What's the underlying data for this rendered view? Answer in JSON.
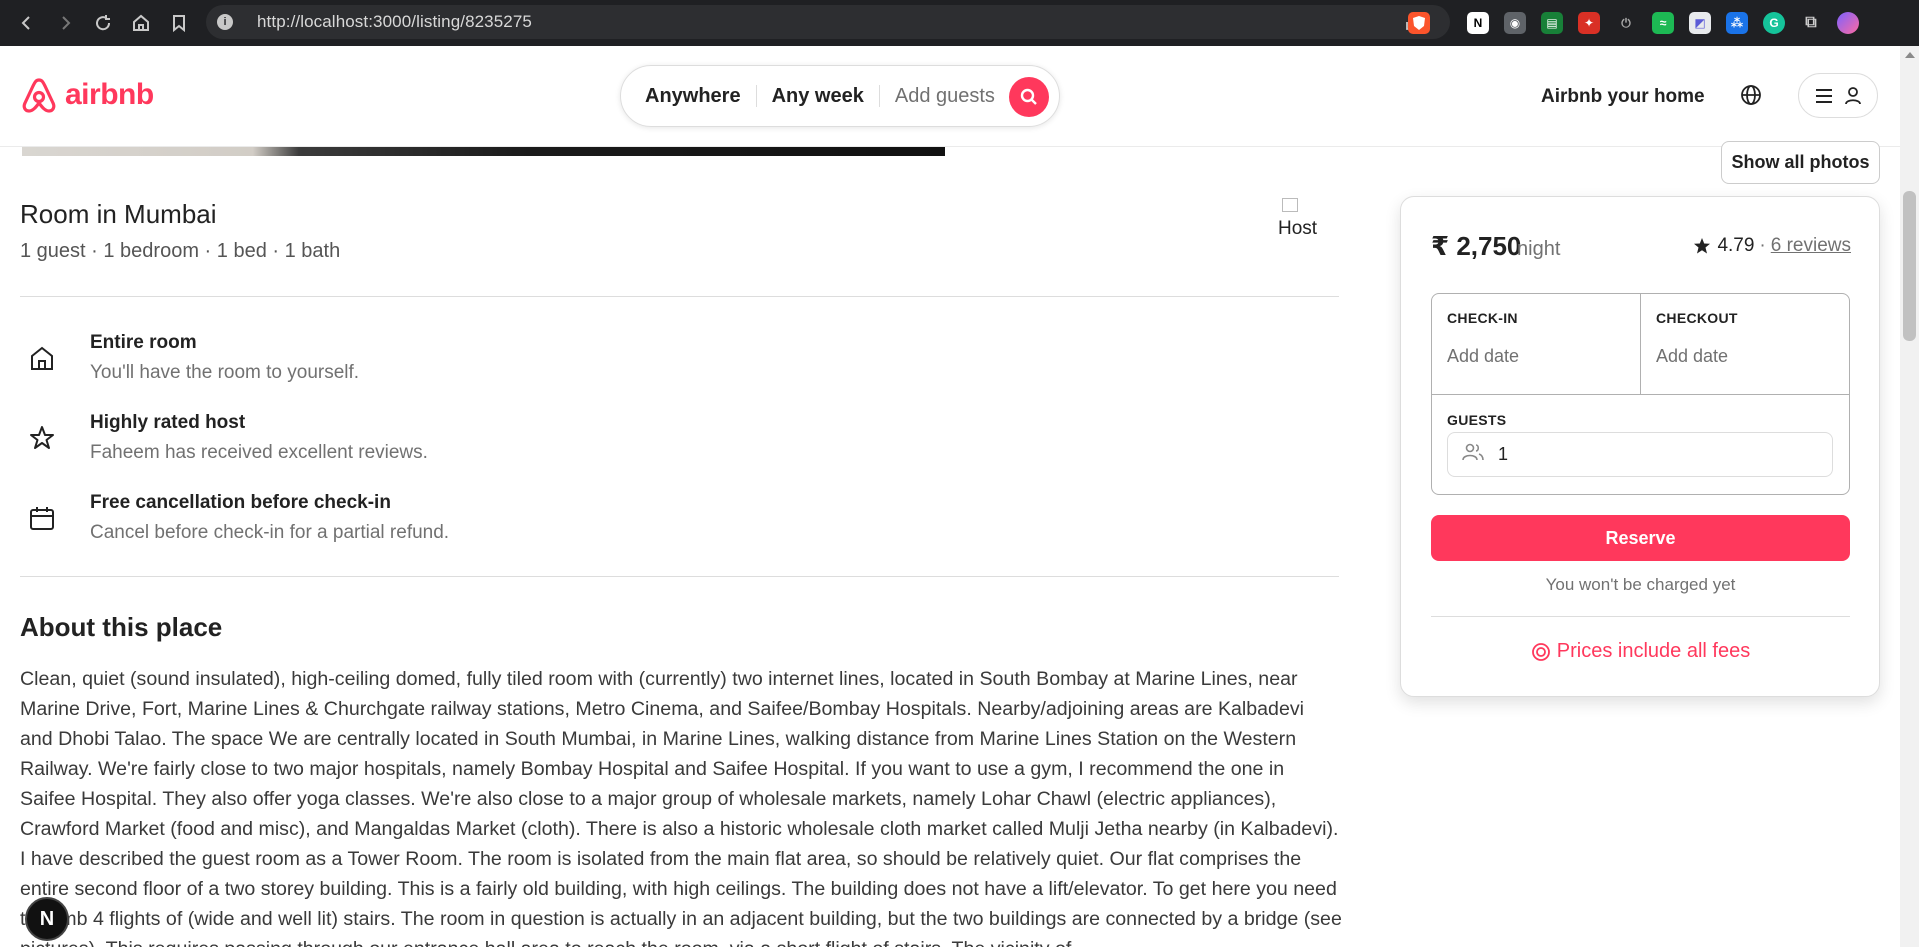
{
  "browser": {
    "url": "http://localhost:3000/listing/8235275",
    "info_icon": "i"
  },
  "header": {
    "logo_text": "airbnb",
    "search": {
      "where": "Anywhere",
      "when": "Any week",
      "guests_placeholder": "Add guests"
    },
    "host_link": "Airbnb your home",
    "brand_color": "#ff385c"
  },
  "gallery": {
    "show_all_photos": "Show all photos"
  },
  "listing": {
    "title": "Room in Mumbai",
    "subtitle": "1 guest · 1 bedroom · 1 bed · 1 bath",
    "host_image_alt": "Host",
    "features": [
      {
        "icon": "home-icon",
        "title": "Entire room",
        "desc": "You'll have the room to yourself."
      },
      {
        "icon": "star-icon",
        "title": "Highly rated host",
        "desc": "Faheem has received excellent reviews."
      },
      {
        "icon": "calendar-icon",
        "title": "Free cancellation before check-in",
        "desc": "Cancel before check-in for a partial refund."
      }
    ],
    "about_title": "About this place",
    "about_text": "Clean, quiet (sound insulated), high-ceiling domed, fully tiled room with (currently) two internet lines, located in South Bombay at Marine Lines, near Marine Drive, Fort, Marine Lines & Churchgate railway stations, Metro Cinema, and Saifee/Bombay Hospitals. Nearby/adjoining areas are Kalbadevi and Dhobi Talao. The space We are centrally located in South Mumbai, in Marine Lines, walking distance from Marine Lines Station on the Western Railway. We're fairly close to two major hospitals, namely Bombay Hospital and Saifee Hospital. If you want to use a gym, I recommend the one in Saifee Hospital. They also offer yoga classes. We're also close to a major group of wholesale markets, namely Lohar Chawl (electric appliances), Crawford Market (food and misc), and Mangaldas Market (cloth). There is also a historic wholesale cloth market called Mulji Jetha nearby (in Kalbadevi). I have described the guest room as a Tower Room. The room is isolated from the main flat area, so should be relatively quiet. Our flat comprises the entire second floor of a two storey building. This is a fairly old building, with high ceilings. The building does not have a lift/elevator. To get here you need to climb 4 flights of (wide and well lit) stairs. The room in question is actually in an adjacent building, but the two buildings are connected by a bridge (see pictures). This requires passing through our entrance hall area to reach the room, via a short flight of stairs. The vicinity of"
  },
  "booking": {
    "price": "₹ 2,750",
    "per": "night",
    "rating": "4.79",
    "separator": "·",
    "reviews": "6 reviews",
    "checkin_label": "CHECK-IN",
    "checkin_value": "Add date",
    "checkout_label": "CHECKOUT",
    "checkout_value": "Add date",
    "guests_label": "GUESTS",
    "guests_value": "1",
    "reserve": "Reserve",
    "no_charge": "You won't be charged yet",
    "fees": "Prices include all fees"
  },
  "dev_badge": "N"
}
